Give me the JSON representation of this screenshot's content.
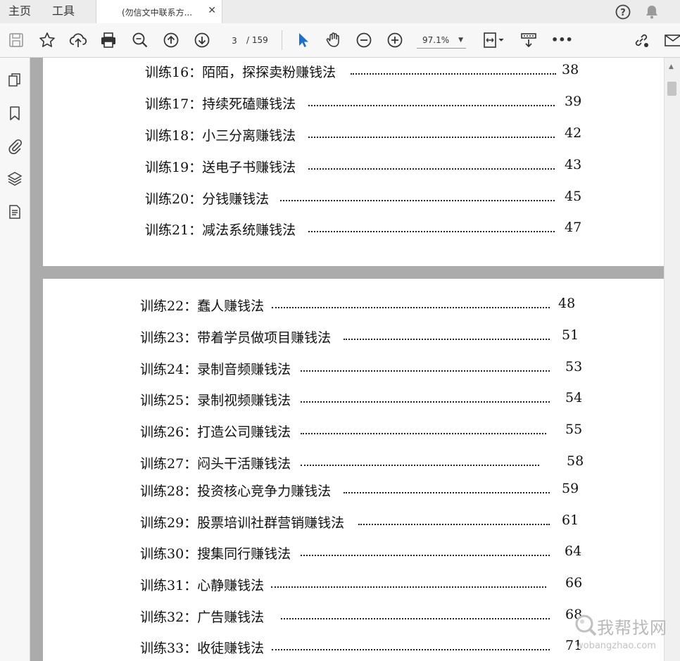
{
  "tabs": {
    "home": "主页",
    "tools": "工具",
    "document_title": "(勿信文中联系方...",
    "close_glyph": "✕"
  },
  "toolbar": {
    "page_current": "3",
    "page_total": "/ 159",
    "zoom": "97.1%",
    "more": "•••"
  },
  "icons": {
    "help": "help-icon",
    "bell": "bell-icon",
    "save": "save-icon",
    "bookmark_star": "star-icon",
    "upload": "upload-cloud-icon",
    "print": "print-icon",
    "zoom_search": "zoom-search-icon",
    "page_up": "arrow-up-circle-icon",
    "page_down": "arrow-down-circle-icon",
    "select_cursor": "cursor-icon",
    "hand": "hand-icon",
    "zoom_out": "minus-circle-icon",
    "zoom_in": "plus-circle-icon",
    "fit_page": "fit-page-icon",
    "scroll_mode": "scroll-mode-icon",
    "share_link": "share-link-icon",
    "email": "email-icon"
  },
  "accent_colors": {
    "cursor": "#1a6fd1",
    "page_bg": "#ffffff",
    "viewer_bg": "#ababab"
  },
  "toc_page1": [
    {
      "label": "训练16：陌陌，探探卖粉赚钱法",
      "page": "38"
    },
    {
      "label": "训练17：持续死磕赚钱法",
      "page": "39"
    },
    {
      "label": "训练18：小三分离赚钱法",
      "page": "42"
    },
    {
      "label": "训练19：送电子书赚钱法",
      "page": "43"
    },
    {
      "label": "训练20：分钱赚钱法",
      "page": "45"
    },
    {
      "label": "训练21：减法系统赚钱法",
      "page": "47"
    }
  ],
  "toc_page2": [
    {
      "label": "训练22：蠢人赚钱法",
      "page": "48"
    },
    {
      "label": "训练23：带着学员做项目赚钱法",
      "page": "51"
    },
    {
      "label": "训练24：录制音频赚钱法",
      "page": "53"
    },
    {
      "label": "训练25：录制视频赚钱法",
      "page": "54"
    },
    {
      "label": "训练26：打造公司赚钱法",
      "page": "55"
    },
    {
      "label": "训练27：闷头干活赚钱法",
      "page": "58"
    },
    {
      "label": "训练28：投资核心竞争力赚钱法",
      "page": "59"
    },
    {
      "label": "训练29：股票培训社群营销赚钱法",
      "page": "61"
    },
    {
      "label": "训练30：搜集同行赚钱法",
      "page": "64"
    },
    {
      "label": "训练31：心静赚钱法",
      "page": "66"
    },
    {
      "label": "训练32：广告赚钱法",
      "page": "68"
    },
    {
      "label": "训练33：收徒赚钱法",
      "page": "71"
    }
  ],
  "watermark": {
    "title": "我帮找网",
    "url": "wobangzhao.com"
  }
}
